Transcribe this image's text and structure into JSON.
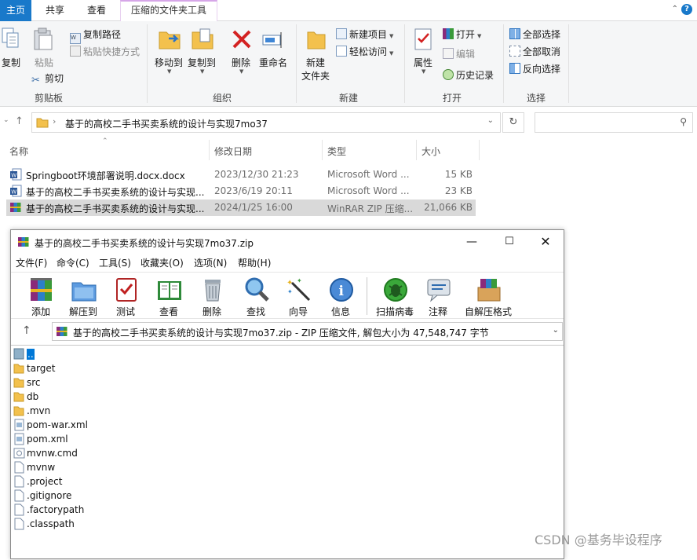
{
  "ribbon_tabs": {
    "home": "主页",
    "share": "共享",
    "view": "查看",
    "context": "压缩的文件夹工具"
  },
  "ribbon": {
    "clipboard": {
      "copy": "复制",
      "paste": "粘贴",
      "copy_path": "复制路径",
      "paste_shortcut": "粘贴快捷方式",
      "cut": "剪切",
      "label": "剪贴板"
    },
    "organize": {
      "move_to": "移动到",
      "copy_to": "复制到",
      "delete": "删除",
      "rename": "重命名",
      "label": "组织"
    },
    "new": {
      "new_folder_line1": "新建",
      "new_folder_line2": "文件夹",
      "new_item": "新建项目",
      "easy_access": "轻松访问",
      "label": "新建"
    },
    "open": {
      "properties": "属性",
      "open": "打开",
      "edit": "编辑",
      "history": "历史记录",
      "label": "打开"
    },
    "select": {
      "select_all": "全部选择",
      "select_none": "全部取消",
      "invert": "反向选择",
      "label": "选择"
    }
  },
  "address": {
    "path": "基于的高校二手书买卖系统的设计与实现7mo37",
    "search_placeholder": ""
  },
  "columns": {
    "name": "名称",
    "date": "修改日期",
    "type": "类型",
    "size": "大小"
  },
  "files": [
    {
      "name": "Springboot环境部署说明.docx.docx",
      "date": "2023/12/30 21:23",
      "type": "Microsoft Word ...",
      "size": "15 KB",
      "icon": "word-doc-icon"
    },
    {
      "name": "基于的高校二手书买卖系统的设计与实现...",
      "date": "2023/6/19 20:11",
      "type": "Microsoft Word ...",
      "size": "23 KB",
      "icon": "word-doc-icon"
    },
    {
      "name": "基于的高校二手书买卖系统的设计与实现...",
      "date": "2024/1/25 16:00",
      "type": "WinRAR ZIP 压缩...",
      "size": "21,066 KB",
      "icon": "winrar-archive-icon",
      "selected": true
    }
  ],
  "rar": {
    "title": "基于的高校二手书买卖系统的设计与实现7mo37.zip",
    "menu": [
      "文件(F)",
      "命令(C)",
      "工具(S)",
      "收藏夹(O)",
      "选项(N)",
      "帮助(H)"
    ],
    "toolbar": [
      "添加",
      "解压到",
      "测试",
      "查看",
      "删除",
      "查找",
      "向导",
      "信息",
      "扫描病毒",
      "注释",
      "自解压格式"
    ],
    "path": "基于的高校二手书买卖系统的设计与实现7mo37.zip - ZIP 压缩文件, 解包大小为 47,548,747 字节",
    "items": [
      {
        "name": "..",
        "kind": "up"
      },
      {
        "name": "target",
        "kind": "folder"
      },
      {
        "name": "src",
        "kind": "folder"
      },
      {
        "name": "db",
        "kind": "folder"
      },
      {
        "name": ".mvn",
        "kind": "folder"
      },
      {
        "name": "pom-war.xml",
        "kind": "xml"
      },
      {
        "name": "pom.xml",
        "kind": "xml"
      },
      {
        "name": "mvnw.cmd",
        "kind": "cmd"
      },
      {
        "name": "mvnw",
        "kind": "file"
      },
      {
        "name": ".project",
        "kind": "file"
      },
      {
        "name": ".gitignore",
        "kind": "file"
      },
      {
        "name": ".factorypath",
        "kind": "file"
      },
      {
        "name": ".classpath",
        "kind": "file"
      }
    ]
  },
  "watermark": "CSDN @基务毕设程序",
  "colors": {
    "accent": "#1979ca",
    "selection": "#d9d9d9",
    "winrar_select": "#0078d7"
  }
}
